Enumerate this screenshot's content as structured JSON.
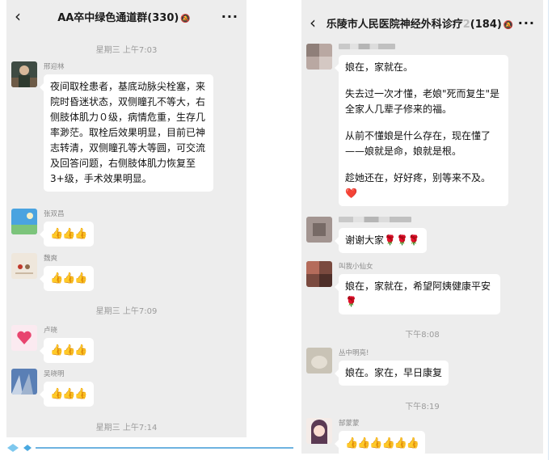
{
  "left": {
    "title": "AA卒中绿色通道群(330)",
    "mute_icon": "bell-off-icon",
    "more": "···",
    "timestamps": [
      "星期三 上午7:03",
      "星期三 上午7:09",
      "星期三 上午7:14"
    ],
    "messages": [
      {
        "sender": "邢迎林",
        "text": "夜间取栓患者，基底动脉尖栓塞，来院时昏迷状态，双侧瞳孔不等大，右侧肢体肌力０级，病情危重，生存几率渺茫。取栓后效果明显，目前已神志转清，双侧瞳孔等大等圆，可交流及回答问题，右侧肢体肌力恢复至3+级，手术效果明显。"
      },
      {
        "sender": "张双昌",
        "emoji": "👍👍👍"
      },
      {
        "sender": "魏爽",
        "emoji": "👍👍👍"
      },
      {
        "sender": "卢晓",
        "emoji": "👍👍👍"
      },
      {
        "sender": "吴晓明",
        "emoji": "👍👍👍"
      }
    ]
  },
  "right": {
    "title": "乐陵市人民医院神经外科诊疗",
    "title_suffix": "2",
    "count": "(184)",
    "mute_icon": "bell-off-icon",
    "more": "···",
    "timestamps": [
      "下午8:08",
      "下午8:19"
    ],
    "messages": [
      {
        "sender": "",
        "paras": [
          "娘在，家就在。",
          "失去过一次才懂，老娘\"死而复生\"是全家人几辈子修来的福。",
          "从前不懂娘是什么存在，现在懂了——娘就是命，娘就是根。",
          "趁她还在，好好疼，别等来不及。❤️"
        ]
      },
      {
        "sender": "",
        "text": "谢谢大家🌹🌹🌹"
      },
      {
        "sender": "叫我小仙女",
        "text": "娘在，家就在，希望阿姨健康平安🌹"
      },
      {
        "sender": "丛中明亮!",
        "text": "娘在。家在，早日康复"
      },
      {
        "sender": "郜蒙蒙",
        "emoji": "👍👍👍👍👍👍"
      }
    ]
  }
}
